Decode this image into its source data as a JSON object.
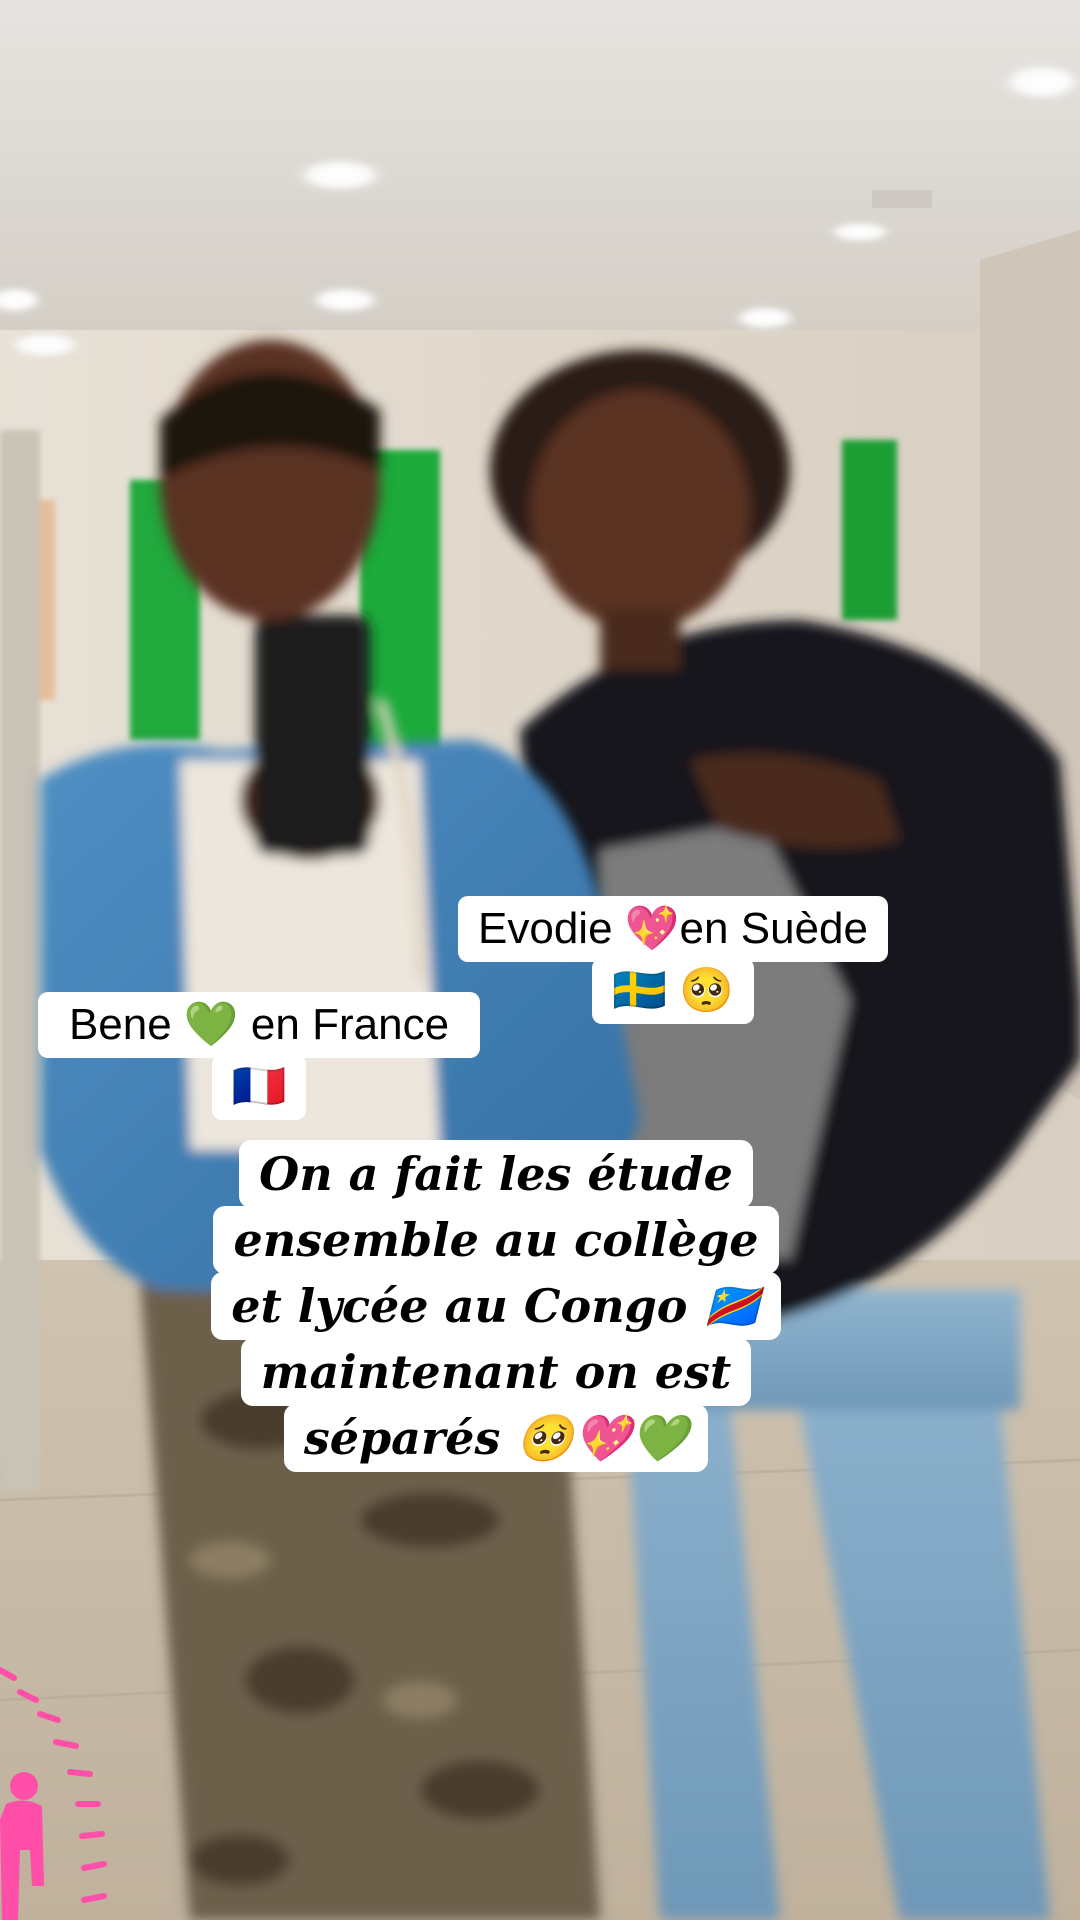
{
  "labels": {
    "evodie": {
      "line1": "Evodie 💖en Suède",
      "line2": "🇸🇪 🥺"
    },
    "bene": {
      "line1": "Bene 💚 en France",
      "line2": "🇫🇷"
    }
  },
  "caption": {
    "lines": [
      "On a fait les étude",
      "ensemble au collège",
      "et lycée au Congo 🇨🇩",
      "maintenant on est",
      "séparés 🥺💖💚"
    ]
  },
  "colors": {
    "caption_background": "#ffffff",
    "caption_text": "#000000",
    "wall_green": "#1faa3a",
    "sticker_pink": "#ff4fa8"
  }
}
